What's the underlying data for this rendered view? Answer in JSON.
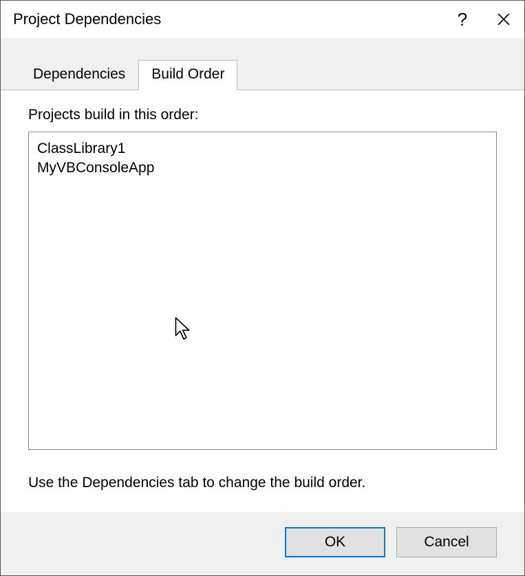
{
  "titlebar": {
    "title": "Project Dependencies"
  },
  "tabs": {
    "dependencies": {
      "label": "Dependencies",
      "active": false
    },
    "buildOrder": {
      "label": "Build Order",
      "active": true
    }
  },
  "panel": {
    "listLabel": "Projects build in this order:",
    "items": [
      "ClassLibrary1",
      "MyVBConsoleApp"
    ],
    "hint": "Use the Dependencies tab to change the build order."
  },
  "buttons": {
    "ok": "OK",
    "cancel": "Cancel"
  }
}
